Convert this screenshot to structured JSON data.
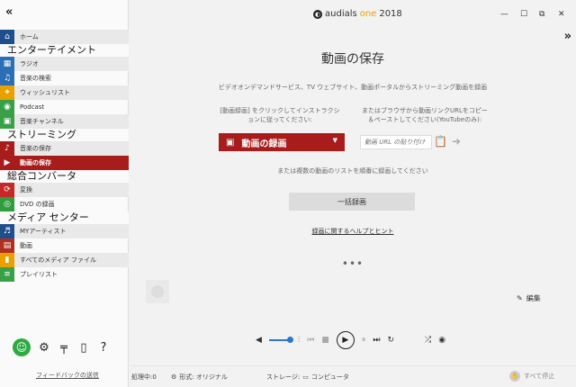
{
  "sidebar": {
    "collapse_icon": "«",
    "sections": {
      "entertainment": "エンターテイメント",
      "streaming": "ストリーミング",
      "converter": "総合コンバータ",
      "media_center": "メディア センター"
    },
    "items": {
      "home": "ホーム",
      "radio": "ラジオ",
      "music_search": "音楽の検索",
      "wishlist": "ウィッシュリスト",
      "podcast": "Podcast",
      "music_channel": "音楽チャンネル",
      "music_save": "音楽の保存",
      "video_save": "動画の保存",
      "convert": "変換",
      "dvd_record": "DVD の録画",
      "my_artists": "MYアーティスト",
      "videos": "動画",
      "all_media": "すべてのメディア ファイル",
      "playlists": "プレイリスト"
    },
    "colors": {
      "home": "#1f4e8c",
      "radio": "#2b6eb5",
      "music_search": "#2b6eb5",
      "wishlist": "#e8a100",
      "podcast": "#3aa047",
      "music_channel": "#3aa047",
      "music_save": "#a81c1c",
      "video_save": "#a81c1c",
      "convert": "#c62828",
      "dvd_record": "#2e9e3e",
      "my_artists": "#1f4e8c",
      "videos": "#b03020",
      "all_media": "#e8a100",
      "playlists": "#3aa047"
    },
    "feedback": "フィードバックの送信"
  },
  "titlebar": {
    "app_name": "audials",
    "app_edition": "one",
    "app_year": "2018",
    "minimize": "—",
    "restore": "☐",
    "maximize": "⧉",
    "close": "✕",
    "expand_icon": "»"
  },
  "main": {
    "title": "動画の保存",
    "subtitle": "ビデオオンデマンドサービス、TV ウェブサイト、動画ポータルからストリーミング動画を録画",
    "left_instruction": "[動画録画] をクリックしてインストラクションに従ってください:",
    "right_instruction": "またはブラウザから動画リンクURLをコピー＆ペーストしてください(YouTubeのみ):",
    "record_button": "動画の録画",
    "url_placeholder": "動画 URL の貼り付け",
    "or_text": "または複数の動画のリストを順番に録画してください",
    "batch_button": "一括録画",
    "help_link": "録画に関するヘルプとヒント",
    "more": "•••",
    "edit": "編集"
  },
  "statusbar": {
    "processing": "処理中:0",
    "format": "形式: オリジナル",
    "storage_label": "ストレージ:",
    "storage_value": "コンピュータ",
    "stop_all": "すべて停止"
  },
  "player": {
    "volume": 0.8
  }
}
